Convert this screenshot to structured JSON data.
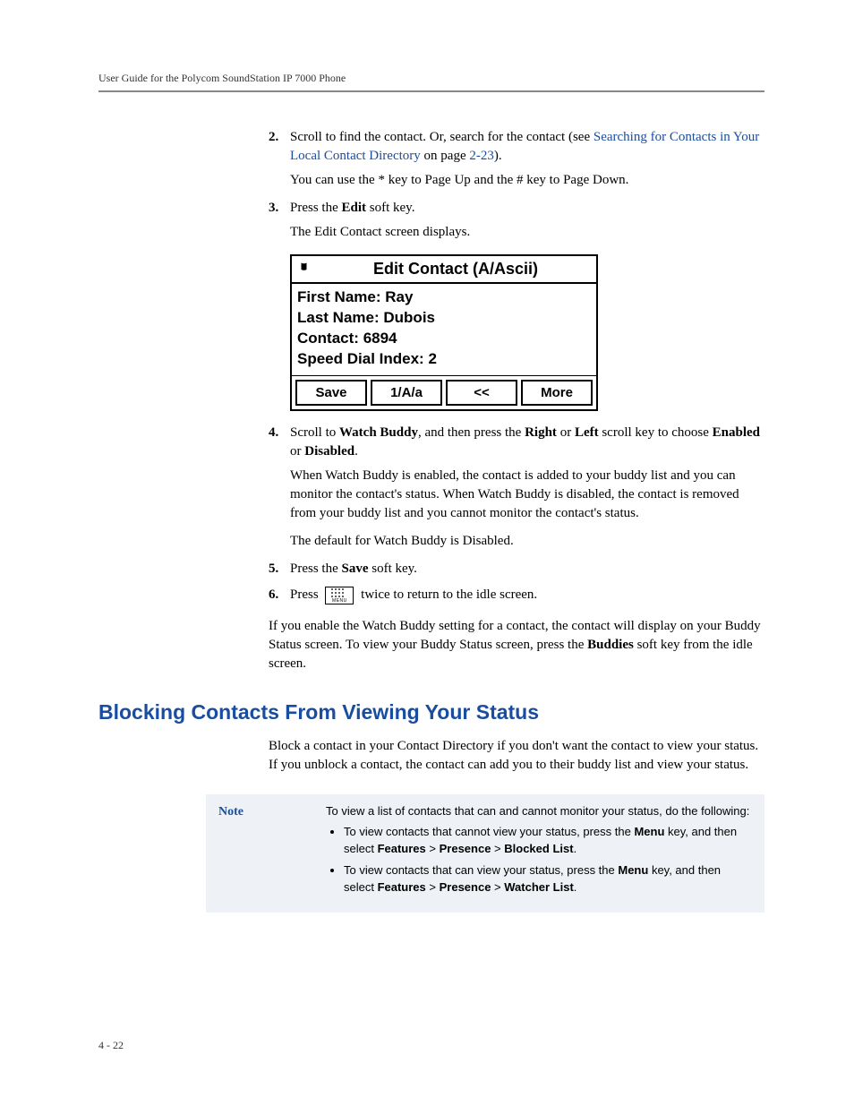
{
  "header": {
    "guide_title": "User Guide for the Polycom SoundStation IP 7000 Phone"
  },
  "steps": {
    "s2": {
      "num": "2.",
      "pre": "Scroll to find the contact. Or, search for the contact (see ",
      "link1": "Searching for Contacts in Your Local Contact Directory",
      "mid": " on page ",
      "pageref": "2-23",
      "post": ").",
      "note": "You can use the * key to Page Up and the # key to Page Down."
    },
    "s3": {
      "num": "3.",
      "pre": "Press the ",
      "bold": "Edit",
      "post": " soft key.",
      "after": "The Edit Contact screen displays."
    },
    "s4": {
      "num": "4.",
      "t1": "Scroll to ",
      "b1": "Watch Buddy",
      "t2": ", and then press the ",
      "b2": "Right",
      "t3": " or ",
      "b3": "Left",
      "t4": " scroll key to choose ",
      "b4": "Enabled",
      "t5": " or ",
      "b5": "Disabled",
      "t6": ".",
      "para2": "When Watch Buddy is enabled, the contact is added to your buddy list and you can monitor the contact's status. When Watch Buddy is disabled, the contact is removed from your buddy list and you cannot monitor the contact's status.",
      "para3": "The default for Watch Buddy is Disabled."
    },
    "s5": {
      "num": "5.",
      "pre": "Press the ",
      "bold": "Save",
      "post": " soft key."
    },
    "s6": {
      "num": "6.",
      "pre": "Press ",
      "post": " twice to return to the idle screen."
    },
    "closing": {
      "t1": "If you enable the Watch Buddy setting for a contact, the contact will display on your Buddy Status screen. To view your Buddy Status screen, press the ",
      "b1": "Buddies",
      "t2": " soft key from the idle screen."
    }
  },
  "chart_data": {
    "type": "table",
    "title": "Edit Contact (A/Ascii)",
    "fields": [
      {
        "label": "First Name",
        "value": "Ray"
      },
      {
        "label": "Last Name",
        "value": "Dubois"
      },
      {
        "label": "Contact",
        "value": "6894"
      },
      {
        "label": "Speed Dial Index",
        "value": "2"
      }
    ],
    "softkeys": [
      "Save",
      "1/A/a",
      "<<",
      "More"
    ]
  },
  "section": {
    "heading": "Blocking Contacts From Viewing Your Status",
    "intro": "Block a contact in your Contact Directory if you don't want the contact to view your status. If you unblock a contact, the contact can add you to their buddy list and view your status."
  },
  "note": {
    "label": "Note",
    "lead": "To view a list of contacts that can and cannot monitor your status, do the following:",
    "bullets": [
      {
        "t1": "To view contacts that cannot view your status, press the ",
        "b1": "Menu",
        "t2": " key, and then select ",
        "b2": "Features",
        "sep": " > ",
        "b3": "Presence",
        "b4": "Blocked List",
        "end": "."
      },
      {
        "t1": "To view contacts that can view your status, press the ",
        "b1": "Menu",
        "t2": " key, and then select ",
        "b2": "Features",
        "sep": " > ",
        "b3": "Presence",
        "b4": "Watcher List",
        "end": "."
      }
    ]
  },
  "footer": {
    "page": "4 - 22"
  }
}
